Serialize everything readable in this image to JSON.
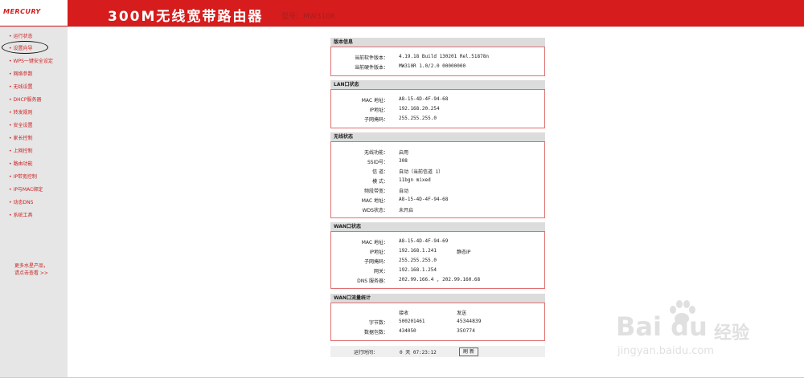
{
  "header": {
    "logo": "MERCURY",
    "title": "300M无线宽带路由器",
    "model": "型号：MW310R"
  },
  "sidebar": {
    "items": [
      {
        "label": "运行状态"
      },
      {
        "label": "设置向导"
      },
      {
        "label": "WPS一键安全设定"
      },
      {
        "label": "网络参数"
      },
      {
        "label": "无线设置"
      },
      {
        "label": "DHCP服务器"
      },
      {
        "label": "转发规则"
      },
      {
        "label": "安全设置"
      },
      {
        "label": "家长控制"
      },
      {
        "label": "上网控制"
      },
      {
        "label": "路由功能"
      },
      {
        "label": "IP带宽控制"
      },
      {
        "label": "IP与MAC绑定"
      },
      {
        "label": "动态DNS"
      },
      {
        "label": "系统工具"
      }
    ],
    "more_line1": "更多水星产品，",
    "more_line2": "请点击查看 >>"
  },
  "version": {
    "title": "版本信息",
    "rows": [
      {
        "label": "当前软件版本：",
        "value": "4.19.18 Build 130201 Rel.51878n"
      },
      {
        "label": "当前硬件版本：",
        "value": "MW310R 1.0/2.0 00000000"
      }
    ]
  },
  "lan": {
    "title": "LAN口状态",
    "rows": [
      {
        "label": "MAC 地址：",
        "value": "A8-15-4D-4F-94-68"
      },
      {
        "label": "IP地址：",
        "value": "192.168.20.254"
      },
      {
        "label": "子网掩码：",
        "value": "255.255.255.0"
      }
    ]
  },
  "wireless": {
    "title": "无线状态",
    "rows": [
      {
        "label": "无线功能：",
        "value": "启用"
      },
      {
        "label": "SSID号：",
        "value": "308"
      },
      {
        "label": "信  道：",
        "value": "自动（当前信道 1）"
      },
      {
        "label": "模  式：",
        "value": "11bgn mixed"
      },
      {
        "label": "频段带宽：",
        "value": "自动"
      },
      {
        "label": "MAC 地址：",
        "value": "A8-15-4D-4F-94-68"
      },
      {
        "label": "WDS状态：",
        "value": "未开启"
      }
    ]
  },
  "wan": {
    "title": "WAN口状态",
    "rows": [
      {
        "label": "MAC 地址：",
        "value": "A8-15-4D-4F-94-69",
        "extra": ""
      },
      {
        "label": "IP地址：",
        "value": "192.168.1.241",
        "extra": "静态IP"
      },
      {
        "label": "子网掩码：",
        "value": "255.255.255.0",
        "extra": ""
      },
      {
        "label": "网关：",
        "value": "192.168.1.254",
        "extra": ""
      },
      {
        "label": "DNS 服务器：",
        "value": "202.99.166.4 , 202.99.160.68",
        "extra": ""
      }
    ]
  },
  "traffic": {
    "title": "WAN口流量统计",
    "col_recv": "接收",
    "col_send": "发送",
    "rows": [
      {
        "label": "字节数：",
        "recv": "500201461",
        "send": "45344839"
      },
      {
        "label": "数据包数：",
        "recv": "434050",
        "send": "350774"
      }
    ]
  },
  "runtime": {
    "label": "运行时间：",
    "value": "0 天 07:23:12",
    "refresh": "刷 新"
  },
  "watermark": {
    "brand": "Bai du",
    "cn": "经验",
    "url": "jingyan.baidu.com"
  },
  "colors": {
    "brand_red": "#d61c1c",
    "nav_text": "#cc2222",
    "sidebar_bg": "#e6e6e6",
    "section_border": "#e07070"
  }
}
